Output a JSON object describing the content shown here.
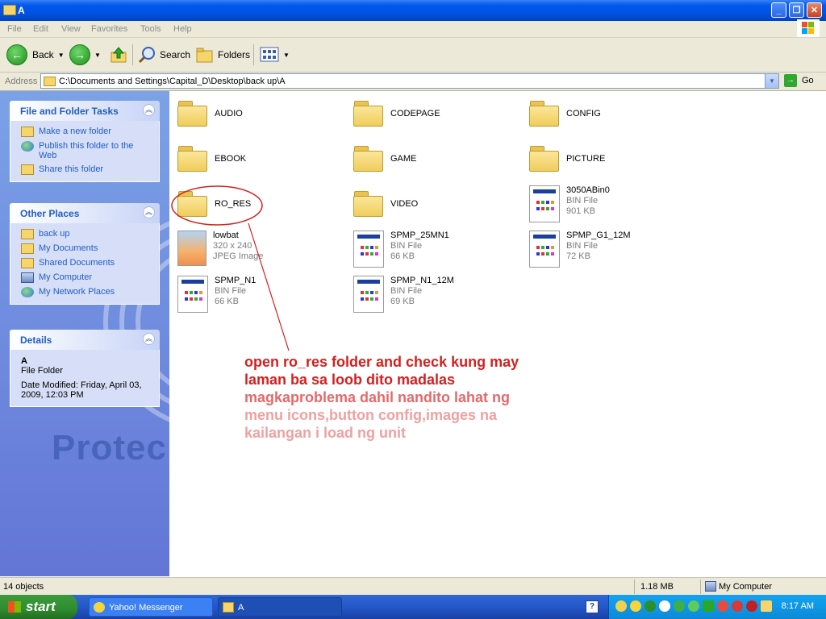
{
  "window": {
    "title": "A",
    "controls": {
      "minimize": "_",
      "maximize": "❐",
      "close": "✕"
    }
  },
  "menubar": {
    "items": [
      "File",
      "Edit",
      "View",
      "Favorites",
      "Tools",
      "Help"
    ]
  },
  "toolbar": {
    "back_label": "Back",
    "search_label": "Search",
    "folders_label": "Folders"
  },
  "address": {
    "label": "Address",
    "value": "C:\\Documents and Settings\\Capital_D\\Desktop\\back up\\A",
    "go_label": "Go"
  },
  "tasks": {
    "file_folder_tasks": {
      "title": "File and Folder Tasks",
      "items": [
        "Make a new folder",
        "Publish this folder to the Web",
        "Share this folder"
      ]
    },
    "other_places": {
      "title": "Other Places",
      "items": [
        "back up",
        "My Documents",
        "Shared Documents",
        "My Computer",
        "My Network Places"
      ]
    },
    "details": {
      "title": "Details",
      "name": "A",
      "type": "File Folder",
      "modified": "Date Modified: Friday, April 03, 2009, 12:03 PM"
    }
  },
  "background_text": "Protec",
  "files": [
    {
      "name": "AUDIO",
      "kind": "folder"
    },
    {
      "name": "CODEPAGE",
      "kind": "folder"
    },
    {
      "name": "CONFIG",
      "kind": "folder"
    },
    {
      "name": "EBOOK",
      "kind": "folder"
    },
    {
      "name": "GAME",
      "kind": "folder"
    },
    {
      "name": "PICTURE",
      "kind": "folder"
    },
    {
      "name": "RO_RES",
      "kind": "folder"
    },
    {
      "name": "VIDEO",
      "kind": "folder"
    },
    {
      "name": "3050ABin0",
      "kind": "bin",
      "type": "BIN File",
      "size": "901 KB"
    },
    {
      "name": "lowbat",
      "kind": "jpg",
      "type": "320 x 240",
      "size": "JPEG Image"
    },
    {
      "name": "SPMP_25MN1",
      "kind": "bin",
      "type": "BIN File",
      "size": "66 KB"
    },
    {
      "name": "SPMP_G1_12M",
      "kind": "bin",
      "type": "BIN File",
      "size": "72 KB"
    },
    {
      "name": "SPMP_N1",
      "kind": "bin",
      "type": "BIN File",
      "size": "66 KB"
    },
    {
      "name": "SPMP_N1_12M",
      "kind": "bin",
      "type": "BIN File",
      "size": "69 KB"
    }
  ],
  "annotation": {
    "lines": [
      "open ro_res folder and check kung may",
      "laman ba sa loob dito madalas",
      "magkaproblema dahil nandito lahat ng",
      "menu icons,button config,images na",
      "kailangan i load ng unit"
    ],
    "color": "#d51f1f"
  },
  "statusbar": {
    "objects": "14 objects",
    "size": "1.18 MB",
    "location": "My Computer"
  },
  "taskbar": {
    "start_label": "start",
    "buttons": [
      "Yahoo! Messenger",
      "A"
    ],
    "clock": "8:17 AM"
  }
}
